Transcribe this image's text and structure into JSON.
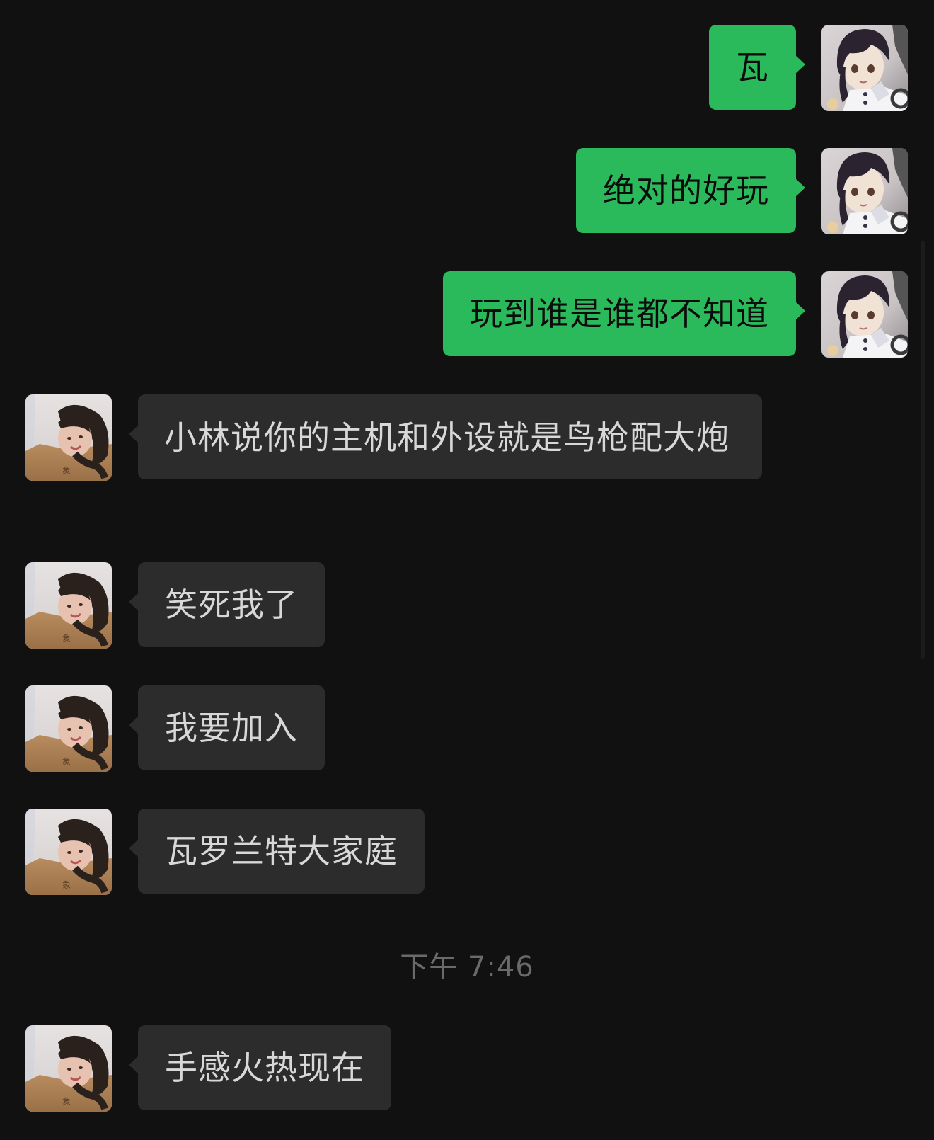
{
  "messages": [
    {
      "direction": "out",
      "text": "瓦",
      "avatar_icon": "anime-girl-avatar-icon"
    },
    {
      "direction": "out",
      "text": "绝对的好玩",
      "avatar_icon": "anime-girl-avatar-icon"
    },
    {
      "direction": "out",
      "text": "玩到谁是谁都不知道",
      "avatar_icon": "anime-girl-avatar-icon"
    },
    {
      "direction": "in",
      "text": "小林说你的主机和外设就是鸟枪配大炮",
      "avatar_icon": "girl-photo-avatar-icon"
    },
    {
      "direction": "in",
      "text": "笑死我了",
      "avatar_icon": "girl-photo-avatar-icon"
    },
    {
      "direction": "in",
      "text": "我要加入",
      "avatar_icon": "girl-photo-avatar-icon"
    },
    {
      "direction": "in",
      "text": "瓦罗兰特大家庭",
      "avatar_icon": "girl-photo-avatar-icon"
    },
    {
      "direction": "in",
      "text": "手感火热现在",
      "avatar_icon": "girl-photo-avatar-icon"
    }
  ],
  "timestamp": "下午 7:46",
  "colors": {
    "background": "#111111",
    "outgoing_bubble": "#2bba5b",
    "incoming_bubble": "#2c2c2c",
    "outgoing_text": "#0c0c0c",
    "incoming_text": "#d8d8d8",
    "timestamp_text": "#6a6a6a"
  }
}
